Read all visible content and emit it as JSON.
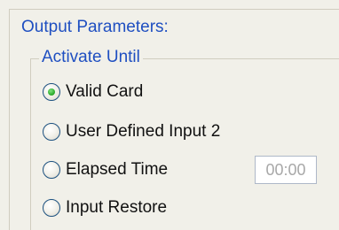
{
  "output_parameters": {
    "title": "Output Parameters:",
    "activate_until": {
      "title": "Activate Until",
      "options": [
        {
          "label": "Valid Card",
          "selected": true
        },
        {
          "label": "User Defined Input 2",
          "selected": false
        },
        {
          "label": "Elapsed Time",
          "selected": false
        },
        {
          "label": "Input Restore",
          "selected": false
        }
      ],
      "elapsed_time_value": "00:00"
    }
  },
  "colors": {
    "group_title": "#1f4fc1",
    "panel_bg": "#f1f0e9",
    "radio_selected": "#2fae2f"
  }
}
